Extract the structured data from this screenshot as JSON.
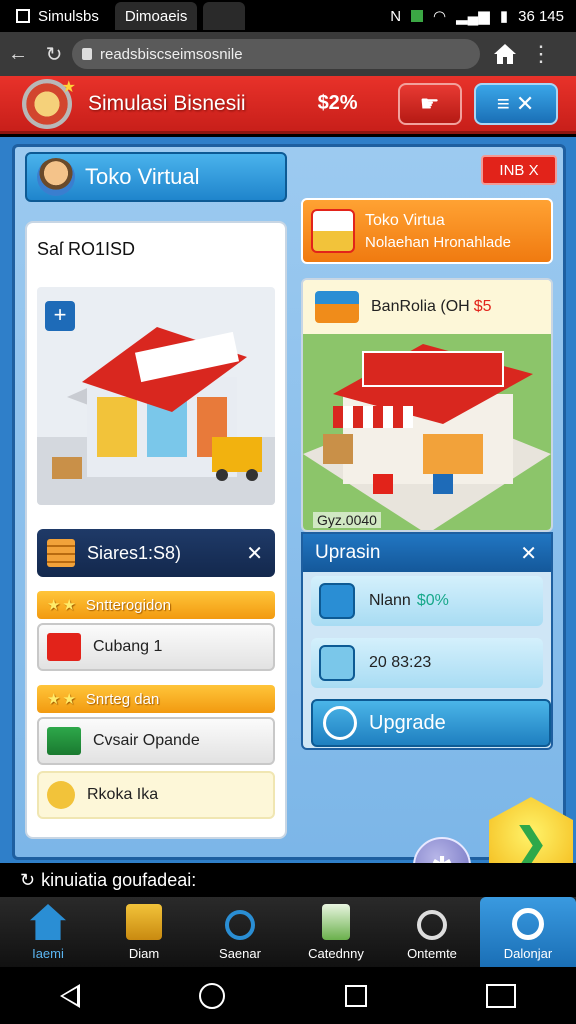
{
  "statusbar": {
    "tab1": "Simulsbs",
    "tab2": "Dimoaeis",
    "right_text": "N",
    "time": "36 145"
  },
  "urlbar": {
    "url": "readsbiscseimsosnile"
  },
  "header": {
    "title": "Simulasi Bisnesii",
    "balance": "$2%",
    "colors": {
      "header_red": "#d9271f",
      "panel_blue": "#2f7fc9"
    }
  },
  "shop": {
    "title": "Toko Virtual",
    "index_button": "INB X",
    "sales_label": "Saſ RO1ISD",
    "plus_label": "+",
    "stat_label": "Siares1:S8)",
    "ribbon1": "Sntterogidon",
    "item1": "Cubang 1",
    "ribbon2": "Snrteg dan",
    "item2": "Cvsair Opande",
    "item3": "Rkoka Ika"
  },
  "notice": {
    "line1": "Toko Virtua",
    "line2": "Nolaehan Hronahlade"
  },
  "right_card": {
    "name": "BanRolia (OH",
    "price": "$5",
    "caption": "Gyz.0040"
  },
  "upgrade": {
    "title": "Uprasin",
    "row1_label": "Nlann",
    "row1_value": "$0%",
    "row2_label": "20 83:23",
    "button": "Upgrade"
  },
  "ticker": {
    "text": "kinuiatia goufadeai:"
  },
  "bottom_nav": {
    "items": [
      "Iaemi",
      "Diam",
      "Saenar",
      "Catednny",
      "Ontemte",
      "Dalonjar"
    ]
  }
}
